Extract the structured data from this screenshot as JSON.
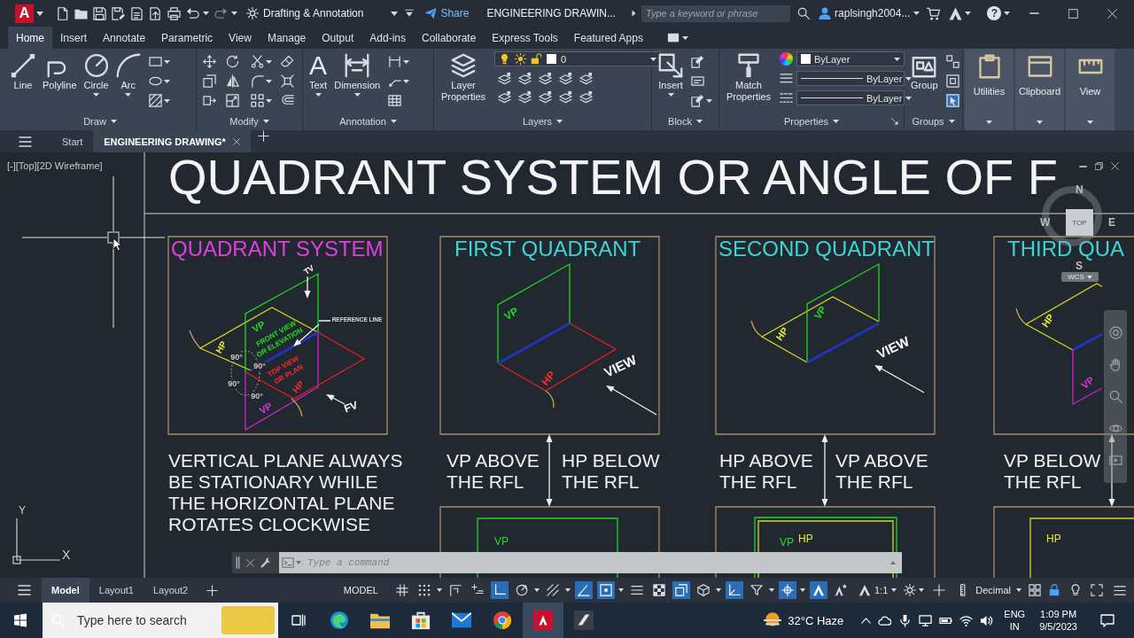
{
  "title_bar": {
    "app_logo": "A",
    "workspace": "Drafting & Annotation",
    "share": "Share",
    "document_title": "ENGINEERING DRAWIN...",
    "search": {
      "placeholder": "Type a keyword or phrase"
    },
    "user": "raplsingh2004...",
    "help": "?"
  },
  "ribbon_tabs": [
    {
      "label": "Home",
      "selected": true
    },
    {
      "label": "Insert",
      "selected": false
    },
    {
      "label": "Annotate",
      "selected": false
    },
    {
      "label": "Parametric",
      "selected": false
    },
    {
      "label": "View",
      "selected": false
    },
    {
      "label": "Manage",
      "selected": false
    },
    {
      "label": "Output",
      "selected": false
    },
    {
      "label": "Add-ins",
      "selected": false
    },
    {
      "label": "Collaborate",
      "selected": false
    },
    {
      "label": "Express Tools",
      "selected": false
    },
    {
      "label": "Featured Apps",
      "selected": false
    }
  ],
  "ribbon_panels": [
    {
      "kind": "draw",
      "title": "Draw",
      "tools": [
        "Line",
        "Polyline",
        "Circle",
        "Arc"
      ]
    },
    {
      "kind": "modify",
      "title": "Modify"
    },
    {
      "kind": "annotation",
      "title": "Annotation",
      "text_glyph": "A",
      "tools": [
        "Text",
        "Dimension"
      ]
    },
    {
      "kind": "layers",
      "title": "Layers",
      "tools": [
        "Layer Properties"
      ],
      "current_layer": "0"
    },
    {
      "kind": "block",
      "title": "Block",
      "tools": [
        "Insert"
      ]
    },
    {
      "kind": "properties",
      "title": "Properties",
      "tools": [
        "Match Properties"
      ],
      "dropdowns": [
        "ByLayer",
        "ByLayer",
        "ByLayer"
      ]
    },
    {
      "kind": "groups",
      "title": "Groups",
      "tools": [
        "Group"
      ]
    },
    {
      "kind": "collapsed",
      "title": "Utilities"
    },
    {
      "kind": "collapsed",
      "title": "Clipboard"
    },
    {
      "kind": "collapsed",
      "title": "View"
    }
  ],
  "file_tabs": [
    {
      "label": "Start",
      "selected": false
    },
    {
      "label": "ENGINEERING DRAWING*",
      "selected": true
    }
  ],
  "viewport_label": "[-][Top][2D Wireframe]",
  "drawing": {
    "title": "QUADRANT SYSTEM OR ANGLE OF F",
    "panels": [
      {
        "kind": "quadrant_system",
        "title": {
          "text": "QUADRANT SYSTEM",
          "color": "#e040e0"
        },
        "labels": [
          {
            "text": "TV",
            "color": "#ffffff"
          },
          {
            "text": "REFERENCE LINE",
            "color": "#dddddd"
          },
          {
            "text": "VP",
            "color": "#22dd22"
          },
          {
            "text": "FRONT VIEW",
            "color": "#22dd22"
          },
          {
            "text": "OR ELEVATION",
            "color": "#22dd22"
          },
          {
            "text": "HP",
            "color": "#e8e830"
          },
          {
            "text": "TOP VIEW",
            "color": "#ff2a2a"
          },
          {
            "text": "OR PLAN",
            "color": "#ff2a2a"
          },
          {
            "text": "HP",
            "color": "#ff2a2a"
          },
          {
            "text": "VP",
            "color": "#dd33dd"
          },
          {
            "text": "FV",
            "color": "#ffffff"
          },
          {
            "text": "90°",
            "color": "#c8c8c8"
          },
          {
            "text": "90°",
            "color": "#c8c8c8"
          },
          {
            "text": "90°",
            "color": "#c8c8c8"
          },
          {
            "text": "90°",
            "color": "#c8c8c8"
          }
        ],
        "note": "VERTICAL PLANE ALWAYS BE STATIONARY WHILE THE HORIZONTAL PLANE ROTATES CLOCKWISE"
      },
      {
        "kind": "first_quadrant",
        "title": {
          "text": "FIRST QUADRANT",
          "color": "#3fd4d4"
        },
        "labels": [
          {
            "text": "VP",
            "color": "#22dd22"
          },
          {
            "text": "HP",
            "color": "#ff2a2a"
          },
          {
            "text": "VIEW",
            "color": "#ffffff"
          }
        ],
        "captions": [
          "VP ABOVE THE RFL",
          "HP BELOW THE RFL"
        ],
        "plan_labels": [
          {
            "text": "VP",
            "color": "#22dd22"
          }
        ]
      },
      {
        "kind": "second_quadrant",
        "title": {
          "text": "SECOND QUADRANT",
          "color": "#3fd4d4"
        },
        "labels": [
          {
            "text": "HP",
            "color": "#e8e830"
          },
          {
            "text": "VP",
            "color": "#22dd22"
          },
          {
            "text": "VIEW",
            "color": "#ffffff"
          }
        ],
        "captions": [
          "HP ABOVE THE RFL",
          "VP ABOVE THE RFL"
        ],
        "plan_labels": [
          {
            "text": "VP",
            "color": "#22dd22"
          },
          {
            "text": "HP",
            "color": "#e8e830"
          }
        ]
      },
      {
        "kind": "third_quadrant",
        "title": {
          "text": "THIRD QUA",
          "color": "#3fd4d4"
        },
        "labels": [
          {
            "text": "HP",
            "color": "#e8e830"
          },
          {
            "text": "VP",
            "color": "#dd33dd"
          }
        ],
        "captions": [
          "VP BELOW THE RFL"
        ],
        "plan_labels": [
          {
            "text": "HP",
            "color": "#e8e830"
          }
        ]
      }
    ]
  },
  "viewcube": {
    "north": "N",
    "west": "W",
    "east": "E",
    "south": "S",
    "face": "TOP",
    "coordinate_system": "WCS"
  },
  "ucs_icon": {
    "y_label": "Y",
    "x_label": "X"
  },
  "command_line": {
    "placeholder": "Type a command"
  },
  "layout_tabs": [
    {
      "label": "Model",
      "selected": true
    },
    {
      "label": "Layout1",
      "selected": false
    },
    {
      "label": "Layout2",
      "selected": false
    }
  ],
  "status_bar": {
    "space": "MODEL",
    "toggles": [
      {
        "on": false
      },
      {
        "on": false
      },
      {
        "on": false
      },
      {
        "on": false
      },
      {
        "on": true
      },
      {
        "on": false
      },
      {
        "on": false
      },
      {
        "on": true
      },
      {
        "on": true
      },
      {
        "on": false
      },
      {
        "on": false
      },
      {
        "on": true
      },
      {
        "on": false
      },
      {
        "on": true
      },
      {
        "on": false
      },
      {
        "on": true
      },
      {
        "on": true
      },
      {
        "on": false
      }
    ],
    "annotation_scale": "1:1",
    "units": "Decimal"
  },
  "taskbar": {
    "search": {
      "placeholder": "Type here to search"
    },
    "apps": [
      {
        "selected": false
      },
      {
        "selected": false
      },
      {
        "selected": false
      },
      {
        "selected": false
      },
      {
        "selected": false
      },
      {
        "selected": true
      },
      {
        "selected": false
      }
    ],
    "weather": "32°C Haze",
    "language": "ENG",
    "region": "IN",
    "time": "1:09 PM",
    "date": "9/5/2023"
  }
}
